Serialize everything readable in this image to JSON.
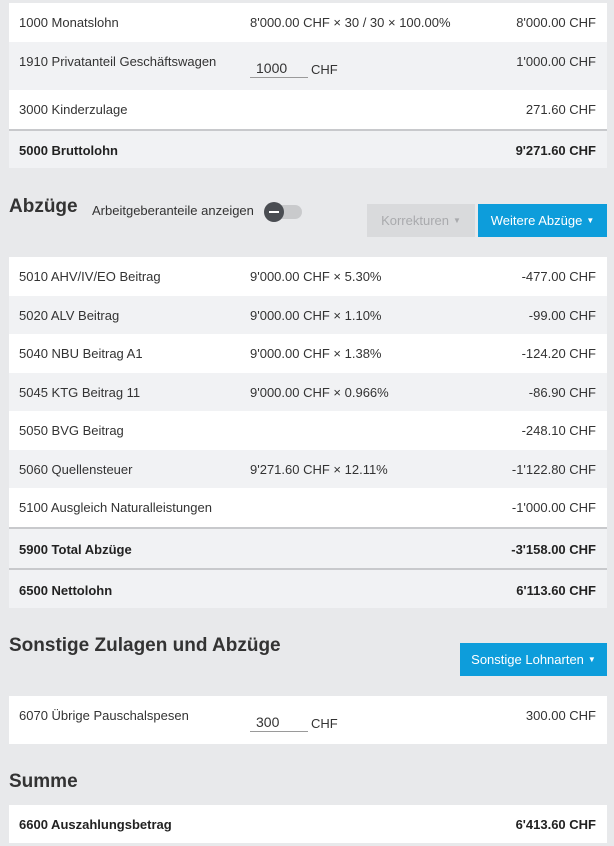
{
  "earnings": [
    {
      "label": "1000 Monatslohn",
      "formula": "8'000.00 CHF × 30 / 30 × 100.00%",
      "amount": "8'000.00 CHF"
    },
    {
      "label": "1910 Privatanteil Geschäftswagen",
      "input_value": "1000",
      "unit": "CHF",
      "amount": "1'000.00 CHF"
    },
    {
      "label": "3000 Kinderzulage",
      "formula": "",
      "amount": "271.60 CHF"
    }
  ],
  "gross": {
    "label": "5000 Bruttolohn",
    "amount": "9'271.60 CHF"
  },
  "deductions_section": {
    "title": "Abzüge",
    "toggle_label": "Arbeitgeberanteile anzeigen",
    "toggle_on": false,
    "corrections_button": "Korrekturen",
    "more_deductions_button": "Weitere Abzüge"
  },
  "deductions": [
    {
      "label": "5010 AHV/IV/EO Beitrag",
      "formula": "9'000.00 CHF × 5.30%",
      "amount": "-477.00 CHF"
    },
    {
      "label": "5020 ALV Beitrag",
      "formula": "9'000.00 CHF × 1.10%",
      "amount": "-99.00 CHF"
    },
    {
      "label": "5040 NBU Beitrag A1",
      "formula": "9'000.00 CHF × 1.38%",
      "amount": "-124.20 CHF"
    },
    {
      "label": "5045 KTG Beitrag 11",
      "formula": "9'000.00 CHF × 0.966%",
      "amount": "-86.90 CHF"
    },
    {
      "label": "5050 BVG Beitrag",
      "formula": "",
      "amount": "-248.10 CHF"
    },
    {
      "label": "5060 Quellensteuer",
      "formula": "9'271.60 CHF × 12.11%",
      "amount": "-1'122.80 CHF"
    },
    {
      "label": "5100 Ausgleich Naturalleistungen",
      "formula": "",
      "amount": "-1'000.00 CHF"
    }
  ],
  "total_deductions": {
    "label": "5900 Total Abzüge",
    "amount": "-3'158.00 CHF"
  },
  "net": {
    "label": "6500 Nettolohn",
    "amount": "6'113.60 CHF"
  },
  "other_section": {
    "title": "Sonstige Zulagen und Abzüge",
    "button": "Sonstige Lohnarten"
  },
  "other_items": [
    {
      "label": "6070 Übrige Pauschalspesen",
      "input_value": "300",
      "unit": "CHF",
      "amount": "300.00 CHF"
    }
  ],
  "sum_section": {
    "title": "Summe"
  },
  "payout": {
    "label": "6600 Auszahlungsbetrag",
    "amount": "6'413.60 CHF"
  },
  "colors": {
    "accent": "#0d9ddb",
    "row_white": "#ffffff",
    "row_grey": "#f1f2f4",
    "background": "#e8e9eb"
  },
  "icons": {
    "dropdown_caret": "caret-down-icon",
    "toggle": "toggle-switch-icon"
  }
}
